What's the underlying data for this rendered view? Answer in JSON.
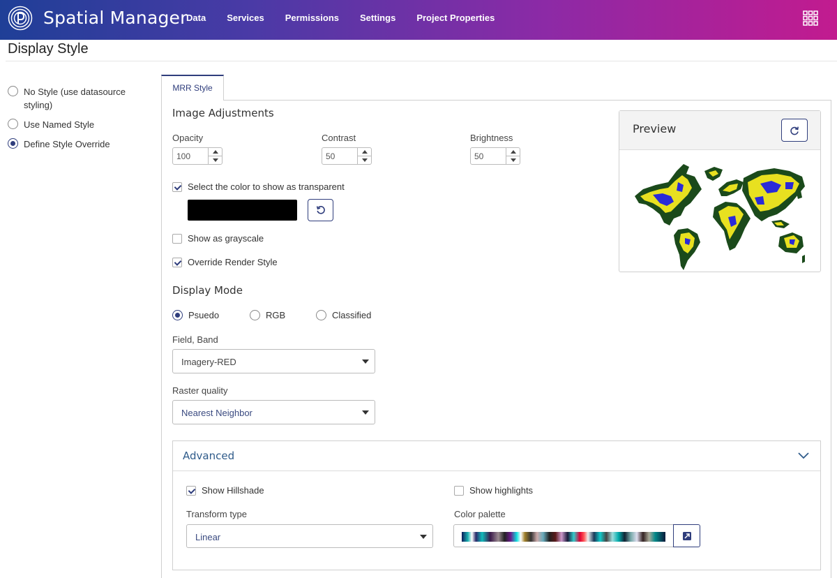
{
  "header": {
    "app_title": "Spatial Manager",
    "nav": [
      "Data",
      "Services",
      "Permissions",
      "Settings",
      "Project Properties"
    ],
    "brand_color": "#8c2aa6"
  },
  "page_title": "Display Style",
  "style_options": [
    {
      "label": "No Style (use datasource styling)",
      "selected": false
    },
    {
      "label": "Use Named Style",
      "selected": false
    },
    {
      "label": "Define Style Override",
      "selected": true
    }
  ],
  "tab": {
    "label": "MRR Style"
  },
  "image_adjustments": {
    "title": "Image Adjustments",
    "opacity": {
      "label": "Opacity",
      "value": "100"
    },
    "contrast": {
      "label": "Contrast",
      "value": "50"
    },
    "brightness": {
      "label": "Brightness",
      "value": "50"
    },
    "transparent_color": {
      "label": "Select the color to show as transparent",
      "checked": true,
      "color": "#000000"
    },
    "grayscale": {
      "label": "Show as grayscale",
      "checked": false
    },
    "override_render": {
      "label": "Override Render Style",
      "checked": true
    }
  },
  "display_mode": {
    "title": "Display Mode",
    "options": [
      {
        "label": "Psuedo",
        "selected": true
      },
      {
        "label": "RGB",
        "selected": false
      },
      {
        "label": "Classified",
        "selected": false
      }
    ],
    "field_band": {
      "label": "Field, Band",
      "value": "Imagery-RED"
    },
    "raster_quality": {
      "label": "Raster quality",
      "value": "Nearest Neighbor"
    }
  },
  "preview": {
    "title": "Preview",
    "refresh_icon": "refresh-icon"
  },
  "advanced": {
    "title": "Advanced",
    "show_hillshade": {
      "label": "Show Hillshade",
      "checked": true
    },
    "show_highlights": {
      "label": "Show highlights",
      "checked": false
    },
    "transform_type": {
      "label": "Transform type",
      "value": "Linear"
    },
    "color_palette": {
      "label": "Color palette",
      "edit_icon": "external-link-icon"
    }
  },
  "accent_color": "#2f3d7c"
}
